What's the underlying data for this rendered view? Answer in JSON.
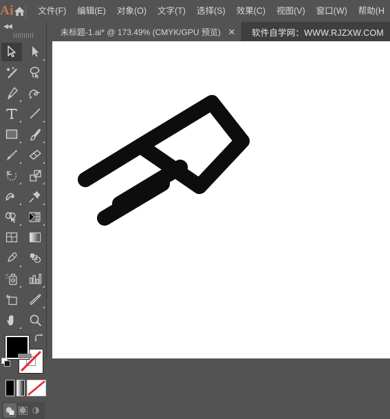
{
  "app": {
    "logo_text": "Ai",
    "home_icon": "home-icon"
  },
  "menubar": {
    "items": [
      {
        "label": "文件(F)",
        "name": "menu-file"
      },
      {
        "label": "编辑(E)",
        "name": "menu-edit"
      },
      {
        "label": "对象(O)",
        "name": "menu-object"
      },
      {
        "label": "文字(T)",
        "name": "menu-type"
      },
      {
        "label": "选择(S)",
        "name": "menu-select"
      },
      {
        "label": "效果(C)",
        "name": "menu-effect"
      },
      {
        "label": "视图(V)",
        "name": "menu-view"
      },
      {
        "label": "窗口(W)",
        "name": "menu-window"
      },
      {
        "label": "帮助(H",
        "name": "menu-help"
      }
    ]
  },
  "tabbar": {
    "document_tab": {
      "label": "未标题-1.ai* @ 173.49% (CMYK/GPU 预览)",
      "close_label": "✕",
      "file_name": "未标题-1.ai*",
      "zoom_level": "173.49%",
      "color_mode": "CMYK/GPU 预览"
    },
    "watermark": "软件自学网：WWW.RJZXW.COM"
  },
  "toolpanel": {
    "collapse_label": "◀◀",
    "tools": [
      {
        "name": "selection-tool",
        "active": true,
        "corner": false
      },
      {
        "name": "direct-selection-tool",
        "active": false,
        "corner": true
      },
      {
        "name": "magic-wand-tool",
        "active": false,
        "corner": false
      },
      {
        "name": "lasso-tool",
        "active": false,
        "corner": false
      },
      {
        "name": "pen-tool",
        "active": false,
        "corner": true
      },
      {
        "name": "curvature-tool",
        "active": false,
        "corner": false
      },
      {
        "name": "type-tool",
        "active": false,
        "corner": true
      },
      {
        "name": "line-segment-tool",
        "active": false,
        "corner": true
      },
      {
        "name": "rectangle-tool",
        "active": false,
        "corner": true
      },
      {
        "name": "paintbrush-tool",
        "active": false,
        "corner": true
      },
      {
        "name": "blob-brush-tool",
        "active": false,
        "corner": true
      },
      {
        "name": "eraser-tool",
        "active": false,
        "corner": true
      },
      {
        "name": "rotate-tool",
        "active": false,
        "corner": true
      },
      {
        "name": "scale-tool",
        "active": false,
        "corner": true
      },
      {
        "name": "width-tool",
        "active": false,
        "corner": true
      },
      {
        "name": "free-transform-tool",
        "active": false,
        "corner": true
      },
      {
        "name": "shape-builder-tool",
        "active": false,
        "corner": true
      },
      {
        "name": "perspective-grid-tool",
        "active": false,
        "corner": true
      },
      {
        "name": "mesh-tool",
        "active": false,
        "corner": false
      },
      {
        "name": "gradient-tool",
        "active": false,
        "corner": false
      },
      {
        "name": "eyedropper-tool",
        "active": false,
        "corner": true
      },
      {
        "name": "blend-tool",
        "active": false,
        "corner": false
      },
      {
        "name": "symbol-sprayer-tool",
        "active": false,
        "corner": true
      },
      {
        "name": "column-graph-tool",
        "active": false,
        "corner": true
      },
      {
        "name": "artboard-tool",
        "active": false,
        "corner": false
      },
      {
        "name": "slice-tool",
        "active": false,
        "corner": true
      },
      {
        "name": "hand-tool",
        "active": false,
        "corner": true
      },
      {
        "name": "zoom-tool",
        "active": false,
        "corner": false
      }
    ],
    "colors": {
      "fill": "#000000",
      "stroke": "none",
      "stroke_none_color": "#e8262a",
      "swap_icon": "swap-fill-stroke-icon",
      "default_icon": "default-fill-stroke-icon"
    },
    "fill_modes": [
      {
        "name": "color-swatch-button",
        "kind": "black"
      },
      {
        "name": "gradient-swatch-button",
        "kind": "gradient"
      },
      {
        "name": "none-swatch-button",
        "kind": "none"
      }
    ],
    "draw_modes": [
      {
        "name": "draw-normal-button",
        "active": true
      },
      {
        "name": "draw-behind-button",
        "active": false
      },
      {
        "name": "draw-inside-button",
        "active": false
      }
    ]
  },
  "canvas": {
    "background": "#ffffff",
    "artwork": {
      "name": "speed-lines-artwork",
      "fill": "#0d0d0d",
      "description": "rotated rounded quadrilateral outline with three trailing speed lines"
    }
  }
}
